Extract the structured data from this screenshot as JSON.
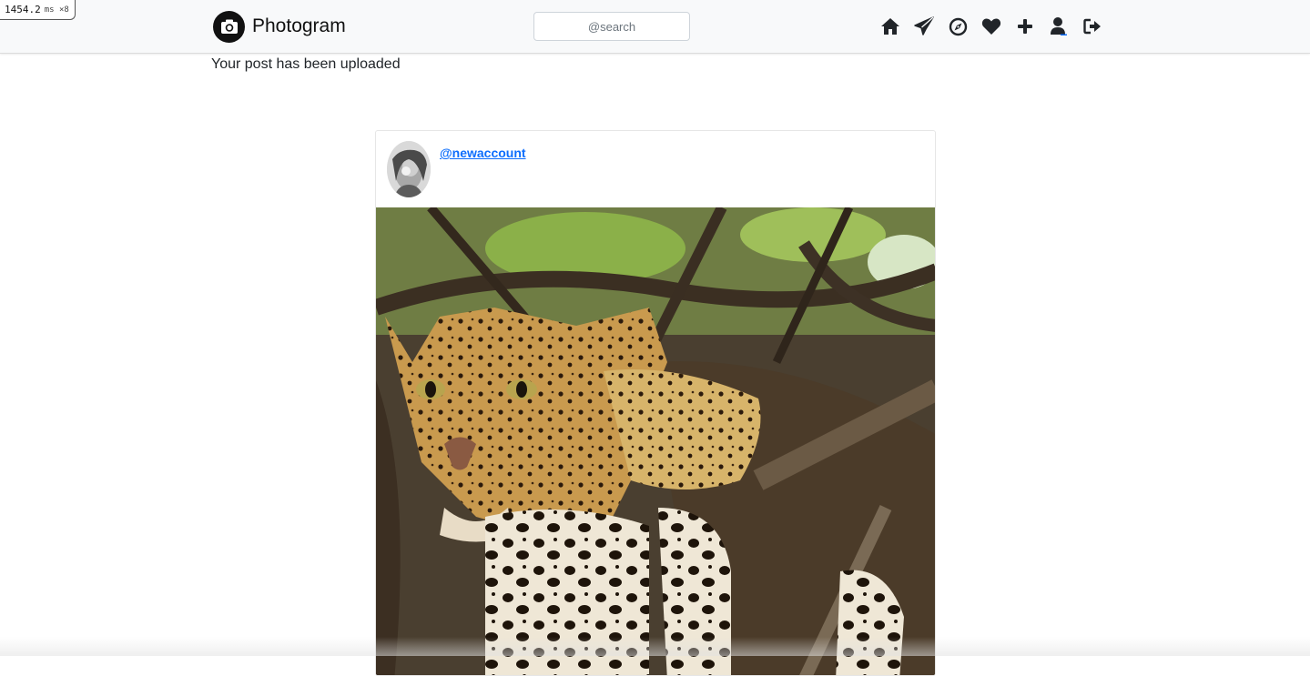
{
  "perf": {
    "value": "1454.2",
    "unit": "ms ×8"
  },
  "navbar": {
    "brand": "Photogram",
    "search": {
      "placeholder": "@search",
      "value": ""
    },
    "icons": [
      "home-icon",
      "send-icon",
      "explore-icon",
      "heart-icon",
      "plus-icon",
      "user-icon",
      "logout-icon"
    ]
  },
  "flash": {
    "message": "Your post has been uploaded"
  },
  "post": {
    "username": "@newaccount",
    "image": "photo-of-leopard-in-tree"
  },
  "colors": {
    "link": "#0d6efd",
    "navbar_bg": "#f8f9fa",
    "icon": "#212529"
  }
}
